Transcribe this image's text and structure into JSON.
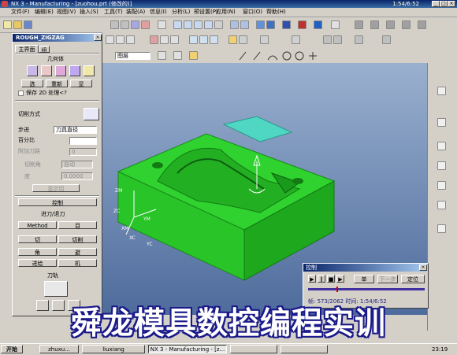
{
  "window": {
    "title": "NX 3 - Manufacturing - [zuohou.prt (修改的)]",
    "time": "1:54/6:52"
  },
  "menu": [
    "文件(F)",
    "编辑(E)",
    "视图(V)",
    "插入(S)",
    "工具(T)",
    "装配(A)",
    "信息(I)",
    "分析(L)",
    "预设置(P)",
    "应用(N)",
    "窗口(O)",
    "帮助(H)"
  ],
  "toolbar": {
    "layer_combo": "图层"
  },
  "dialog": {
    "title": "ROUGH_ZIGZAG",
    "tab_main": "主界面",
    "tab_group": "组",
    "geometry_label": "几何体",
    "btn_select": "选",
    "btn_reselect": "重新",
    "btn_display": "显",
    "keep_2d": "保存 2D 处理<?",
    "cut_method_label": "切削方式",
    "stepover_label": "步进",
    "stepover_value": "刀具直径",
    "percent_label": "百分比",
    "percent_value": "",
    "extra_passes_label": "附加刀路",
    "extra_passes_value": "0",
    "cut_angle_label": "切削角",
    "cut_angle_value": "自动",
    "degree_label": "度",
    "degree_value": "0.0000",
    "display_cut_btn": "显示切",
    "control_btn": "控制",
    "engage_label": "进刀/退刀",
    "method_btn": "Method",
    "method_value": "目",
    "cut_btn": "切",
    "cut_param_btn": "切削",
    "corner_btn": "角",
    "avoid_btn": "避",
    "feed_btn": "进给",
    "machine_btn": "机",
    "toolpath_label": "刀轨"
  },
  "viewport": {
    "axes": [
      "ZM",
      "ZC",
      "YM",
      "XM",
      "XC",
      "YC"
    ]
  },
  "control_panel": {
    "title": "控制",
    "btn_step": "单",
    "btn_next": "下一步",
    "btn_locate": "定位",
    "status": "帧: 573/2062  时间: 1:54/6:52"
  },
  "watermark": "舜龙模具数控编程实训",
  "taskbar": {
    "start": "开始",
    "tasks": [
      "zhuxu...",
      "liuxiang",
      "NX 3 - Manufacturing - [z...",
      "",
      ""
    ],
    "clock": "23:19"
  },
  "colors": {
    "part": "#2fd22f",
    "viewport_top": "#9ab0cf",
    "viewport_bottom": "#4e6b9c",
    "stock_highlight": "#4fd7c3"
  }
}
